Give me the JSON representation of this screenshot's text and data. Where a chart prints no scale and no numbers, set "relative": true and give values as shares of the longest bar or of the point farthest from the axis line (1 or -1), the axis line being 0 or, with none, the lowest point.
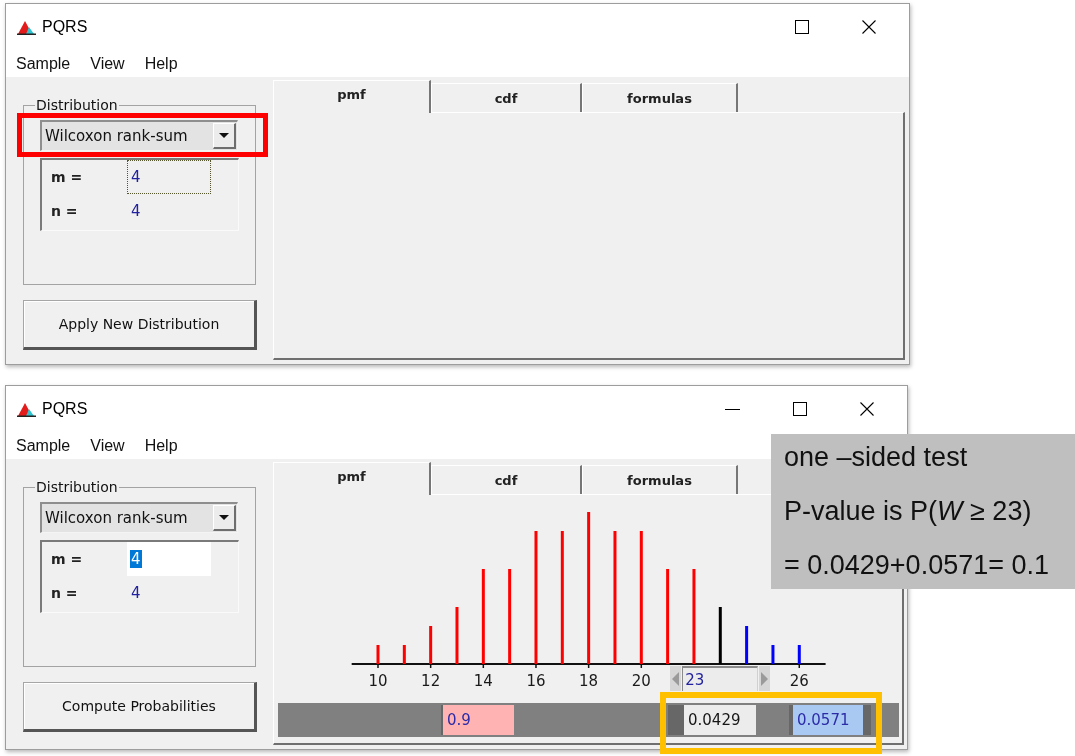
{
  "windows": [
    {
      "title": "PQRS",
      "controls": [
        {
          "kind": "maximize"
        },
        {
          "kind": "close"
        }
      ],
      "menu": [
        "Sample",
        "View",
        "Help"
      ],
      "distribution": {
        "legend": "Distribution",
        "value": "Wilcoxon rank-sum",
        "highlight": {
          "color": "#ff0000"
        },
        "params": [
          {
            "label": "m =",
            "value": "4",
            "focused": true,
            "text_selected": false
          },
          {
            "label": "n =",
            "value": "4",
            "focused": false,
            "text_selected": false
          }
        ]
      },
      "action_button": "Apply New Distribution",
      "tabs": [
        {
          "label": "pmf",
          "selected": true
        },
        {
          "label": "cdf",
          "selected": false
        },
        {
          "label": "formulas",
          "selected": false
        }
      ]
    },
    {
      "title": "PQRS",
      "controls": [
        {
          "kind": "minimize"
        },
        {
          "kind": "maximize"
        },
        {
          "kind": "close"
        }
      ],
      "menu": [
        "Sample",
        "View",
        "Help"
      ],
      "distribution": {
        "legend": "Distribution",
        "value": "Wilcoxon rank-sum",
        "params": [
          {
            "label": "m =",
            "value": "4",
            "focused": false,
            "text_selected": true
          },
          {
            "label": "n =",
            "value": "4",
            "focused": false,
            "text_selected": false
          }
        ]
      },
      "action_button": "Compute Probabilities",
      "tabs": [
        {
          "label": "pmf",
          "selected": true
        },
        {
          "label": "cdf",
          "selected": false
        },
        {
          "label": "formulas",
          "selected": false
        }
      ],
      "plot": {
        "chart_data": {
          "type": "bar",
          "relative": true,
          "x": [
            10,
            11,
            12,
            13,
            14,
            15,
            16,
            17,
            18,
            19,
            20,
            21,
            22,
            23,
            24,
            25,
            26
          ],
          "series": [
            {
              "color": "#ff0000",
              "values": [
                0.125,
                0.125,
                0.25,
                0.375,
                0.625,
                0.625,
                0.875,
                0.875,
                1,
                0.875,
                0.875,
                0.625,
                0.625,
                null,
                null,
                null,
                null
              ]
            },
            {
              "color": "#000000",
              "values": [
                null,
                null,
                null,
                null,
                null,
                null,
                null,
                null,
                null,
                null,
                null,
                null,
                null,
                0.375,
                null,
                null,
                null
              ]
            },
            {
              "color": "#0000ff",
              "values": [
                null,
                null,
                null,
                null,
                null,
                null,
                null,
                null,
                null,
                null,
                null,
                null,
                null,
                null,
                0.25,
                0.125,
                0.125
              ]
            }
          ],
          "xlim": [
            9,
            27
          ],
          "xticks": [
            10,
            12,
            14,
            16,
            18,
            20,
            26
          ]
        },
        "spinner": {
          "value": "23"
        },
        "probabilities": [
          {
            "kind": "tail",
            "value": "0.9",
            "color": "#ffb3b3"
          },
          {
            "kind": "point",
            "value": "0.0429",
            "color": "#ececec"
          },
          {
            "kind": "tail",
            "value": "0.0571",
            "color": "#a9c9f3"
          }
        ],
        "highlight": {
          "color": "#ffc000"
        }
      }
    }
  ],
  "note": {
    "lines": [
      "one –sided test",
      "P-value is P(*W* ≥ 23)",
      "= 0.0429+0.0571= 0.1"
    ]
  }
}
